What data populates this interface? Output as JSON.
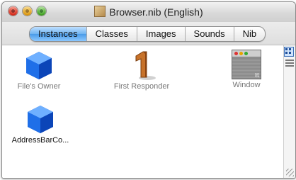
{
  "window": {
    "title": "Browser.nib (English)"
  },
  "tabs": [
    {
      "label": "Instances",
      "active": true
    },
    {
      "label": "Classes",
      "active": false
    },
    {
      "label": "Images",
      "active": false
    },
    {
      "label": "Sounds",
      "active": false
    },
    {
      "label": "Nib",
      "active": false
    }
  ],
  "instances": [
    {
      "label": "File's Owner",
      "icon": "blue-cube-icon"
    },
    {
      "label": "First Responder",
      "icon": "first-responder-icon"
    },
    {
      "label": "Window",
      "icon": "window-icon",
      "selected": true
    },
    {
      "label": "AddressBarCo...",
      "icon": "blue-cube-icon"
    }
  ],
  "view_controls": {
    "icon_view": "icon-view-icon",
    "list_view": "list-view-icon"
  },
  "colors": {
    "selection_highlight": "#b8ee78",
    "tab_active": "#4a9be8",
    "cube_blue": "#1a62e0"
  }
}
